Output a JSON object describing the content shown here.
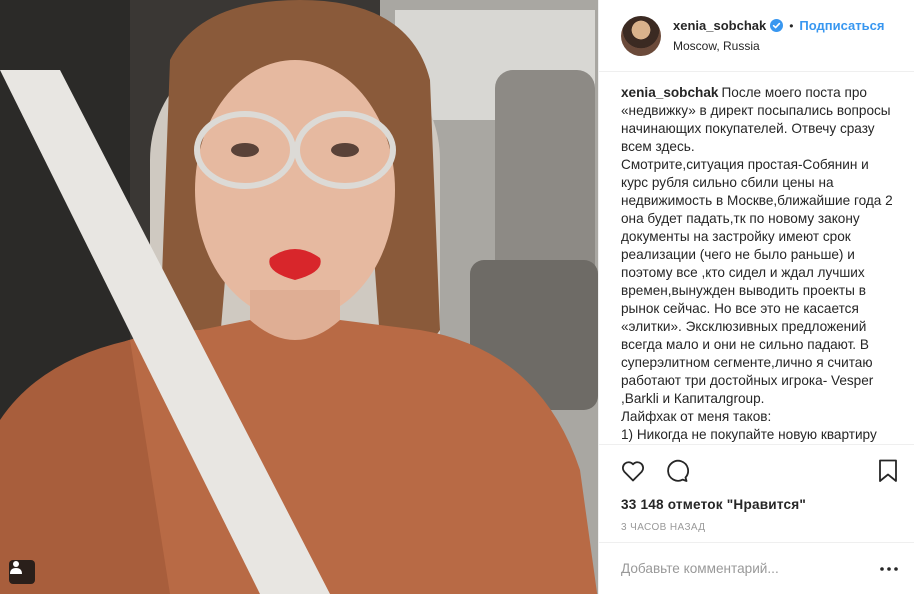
{
  "post": {
    "username": "xenia_sobchak",
    "separator": "•",
    "follow_label": "Подписаться",
    "location": "Moscow, Russia",
    "caption_author": "xenia_sobchak",
    "caption_lines": [
      "После моего поста про «недвижку» в директ посыпались вопросы начинающих покупателей. Отвечу сразу всем здесь.",
      "Смотрите,ситуация простая-Собянин и курс рубля сильно сбили цены на недвижимость в Москве,ближайшие года 2 она будет падать,тк по новому закону документы на застройку имеют срок реализации (чего не было раньше) и поэтому все ,кто сидел и ждал лучших времен,вынужден выводить проекты в рынок сейчас. Но все это не касается «элитки». Эксклюзивных предложений всегда мало и они не сильно падают. В суперэлитном сегменте,лично я считаю работают три достойных игрока- Vesper ,Barkli и Капиталgroup.",
      "Лайфхак от меня таков:",
      "1) Никогда не покупайте новую квартиру"
    ],
    "likes_text": "33 148 отметок \"Нравится\"",
    "time_text": "3 часов назад",
    "comment_placeholder": "Добавьте комментарий..."
  },
  "icons": {
    "verified": "verified-badge-icon",
    "like": "heart-icon",
    "comment": "comment-bubble-icon",
    "save": "bookmark-icon",
    "more": "ellipsis-icon",
    "tagged": "person-tag-icon"
  },
  "colors": {
    "accent": "#3897f0",
    "text": "#262626",
    "muted": "#999999",
    "divider": "#efefef",
    "lips": "#d8262b",
    "top": "#b86a45"
  }
}
